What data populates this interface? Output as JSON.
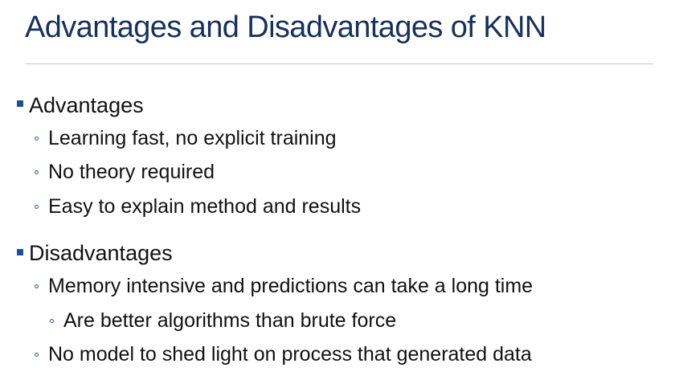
{
  "slide": {
    "title": "Advantages and Disadvantages of KNN",
    "sections": [
      {
        "heading": "Advantages",
        "items": [
          "Learning fast, no explicit training",
          "No theory required",
          "Easy to explain method and results"
        ]
      },
      {
        "heading": "Disadvantages",
        "items": [
          "Memory intensive and predictions can take a long time",
          "Are better algorithms than brute force",
          "No model to shed light on process that generated data"
        ]
      }
    ]
  },
  "colors": {
    "title": "#17305e",
    "bullet_square": "#1f4e9a",
    "bullet_circle": "#2b5aa8",
    "text": "#111111",
    "rule": "#c8c8c8"
  },
  "icons": {
    "level1_bullet": "square-bullet-icon",
    "level2_bullet": "circle-bullet-icon"
  }
}
